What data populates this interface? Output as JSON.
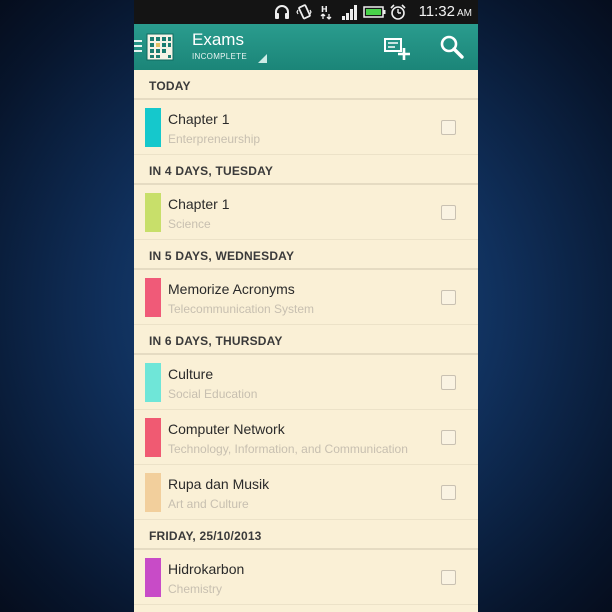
{
  "status_bar": {
    "time": "11:32",
    "ampm": "AM",
    "icons": [
      "headset-icon",
      "vibrate-icon",
      "hspa-icon",
      "signal-icon",
      "battery-icon",
      "alarm-icon"
    ]
  },
  "app_bar": {
    "title": "Exams",
    "filter": "INCOMPLETE",
    "color": "#1f8f82"
  },
  "sections": [
    {
      "header": "TODAY",
      "items": [
        {
          "title": "Chapter 1",
          "subtitle": "Enterpreneurship",
          "color": "#15c8cc"
        }
      ]
    },
    {
      "header": "IN 4 DAYS, TUESDAY",
      "items": [
        {
          "title": "Chapter 1",
          "subtitle": "Science",
          "color": "#c8df6a"
        }
      ]
    },
    {
      "header": "IN 5 DAYS, WEDNESDAY",
      "items": [
        {
          "title": "Memorize Acronyms",
          "subtitle": "Telecommunication System",
          "color": "#f05a78"
        }
      ]
    },
    {
      "header": "IN 6 DAYS, THURSDAY",
      "items": [
        {
          "title": "Culture",
          "subtitle": "Social Education",
          "color": "#6fe6d8"
        },
        {
          "title": "Computer Network",
          "subtitle": "Technology, Information, and Communication",
          "color": "#f05a72"
        },
        {
          "title": "Rupa dan Musik",
          "subtitle": "Art and Culture",
          "color": "#f2cf9c"
        }
      ]
    },
    {
      "header": "FRIDAY, 25/10/2013",
      "items": [
        {
          "title": "Hidrokarbon",
          "subtitle": "Chemistry",
          "color": "#c84bc7"
        }
      ]
    }
  ]
}
